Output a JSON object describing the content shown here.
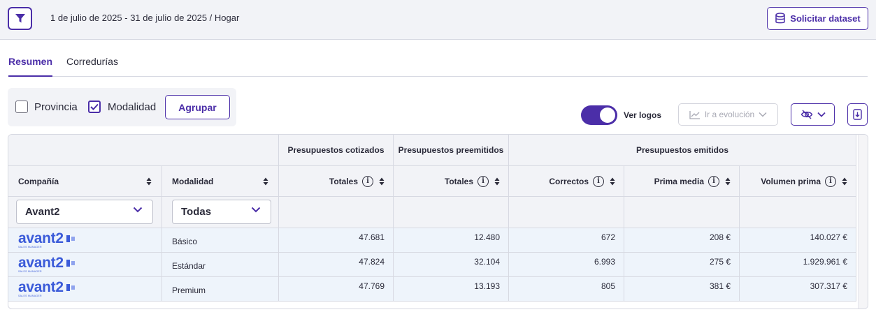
{
  "header": {
    "title": "1 de julio de 2025 - 31 de julio de 2025 / Hogar",
    "dataset_label": "Solicitar dataset"
  },
  "tabs": [
    {
      "label": "Resumen",
      "active": true
    },
    {
      "label": "Corredurías",
      "active": false
    }
  ],
  "grouping": {
    "provincia_label": "Provincia",
    "provincia_checked": false,
    "modalidad_label": "Modalidad",
    "modalidad_checked": true,
    "agrupar_label": "Agrupar"
  },
  "controls": {
    "ver_logos_label": "Ver logos",
    "ver_logos_on": true,
    "evolucion_label": "Ir a evolución"
  },
  "table": {
    "group_headers": {
      "cotizados": "Presupuestos cotizados",
      "preemitidos": "Presupuestos preemitidos",
      "emitidos": "Presupuestos emitidos"
    },
    "columns": {
      "compania": "Compañía",
      "modalidad": "Modalidad",
      "totales_cotizados": "Totales",
      "totales_preemitidos": "Totales",
      "correctos": "Correctos",
      "prima_media": "Prima media",
      "volumen_prima": "Volumen prima"
    },
    "filters": {
      "compania": "Avant2",
      "modalidad": "Todas"
    },
    "logo": {
      "text": "avant2",
      "subtext": "SALES MANAGER"
    },
    "rows": [
      {
        "modalidad": "Básico",
        "cotizados": "47.681",
        "preemitidos": "12.480",
        "correctos": "672",
        "prima_media": "208 €",
        "volumen_prima": "140.027 €"
      },
      {
        "modalidad": "Estándar",
        "cotizados": "47.824",
        "preemitidos": "32.104",
        "correctos": "6.993",
        "prima_media": "275 €",
        "volumen_prima": "1.929.961 €"
      },
      {
        "modalidad": "Premium",
        "cotizados": "47.769",
        "preemitidos": "13.193",
        "correctos": "805",
        "prima_media": "381 €",
        "volumen_prima": "307.317 €"
      }
    ]
  },
  "colors": {
    "accent": "#4b2ea8",
    "logo_blue": "#3b5bd9",
    "row_bg": "#eef4fb",
    "header_bg": "#f2f3f7"
  }
}
